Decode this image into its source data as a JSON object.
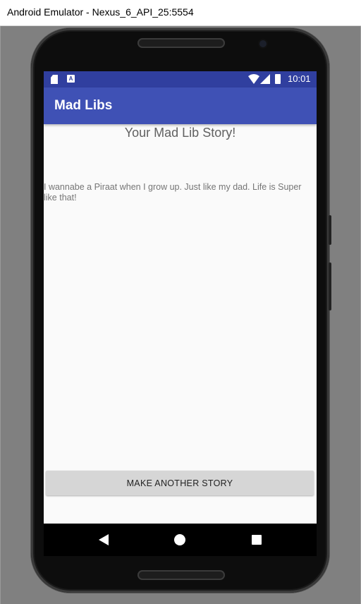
{
  "window": {
    "title": "Android Emulator - Nexus_6_API_25:5554"
  },
  "statusbar": {
    "time": "10:01",
    "icons": [
      "sd-card-icon",
      "a-icon",
      "wifi-icon",
      "signal-icon",
      "battery-charging-icon"
    ],
    "color": "#303f9f"
  },
  "appbar": {
    "title": "Mad Libs",
    "color": "#3f51b5"
  },
  "story": {
    "heading": "Your Mad Lib Story!",
    "text": "I wannabe a Piraat when I grow up. Just like my dad. Life is Super like that!"
  },
  "actions": {
    "make_another_label": "MAKE ANOTHER STORY"
  },
  "navbar": {
    "icons": [
      "back-icon",
      "home-icon",
      "recents-icon"
    ]
  }
}
